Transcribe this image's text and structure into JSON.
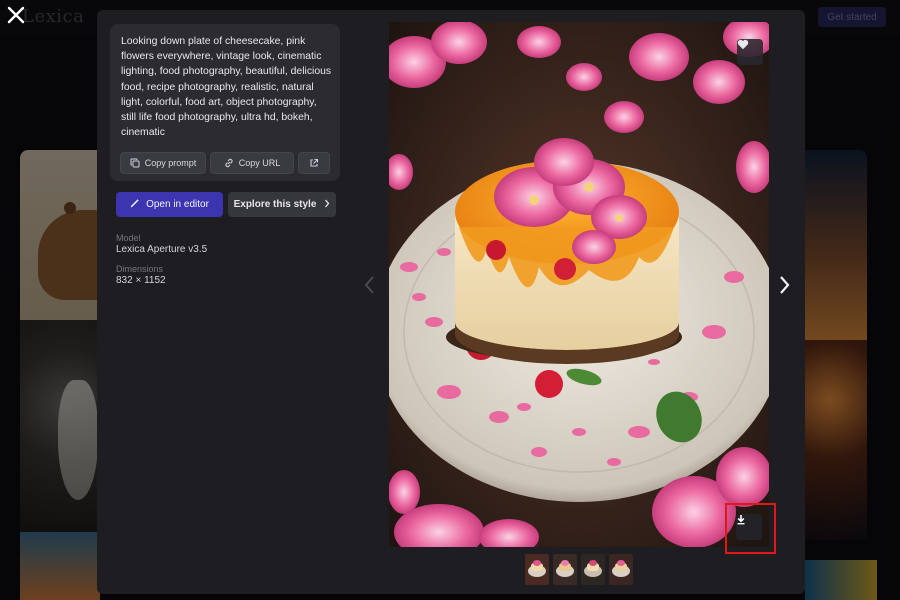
{
  "background": {
    "logo_text": "Lexica",
    "get_started_label": "Get started"
  },
  "prompt": {
    "text": "Looking down plate of cheesecake, pink flowers everywhere, vintage look, cinematic lighting, food photography, beautiful, delicious food, recipe photography, realistic, natural light, colorful, food art, object photography, still life food photography, ultra hd, bokeh, cinematic",
    "copy_prompt_label": "Copy prompt",
    "copy_url_label": "Copy URL"
  },
  "actions": {
    "open_in_editor_label": "Open in editor",
    "explore_style_label": "Explore this style"
  },
  "meta": {
    "model_label": "Model",
    "model_value": "Lexica Aperture v3.5",
    "dimensions_label": "Dimensions",
    "dimensions_value": "832 × 1152"
  },
  "colors": {
    "accent": "#3d35b0",
    "highlight_box": "#e01818",
    "modal_bg": "#1d1d22"
  },
  "icons": {
    "close": "close-icon",
    "copy": "copy-icon",
    "link": "link-icon",
    "external": "external-link-icon",
    "wand": "magic-wand-icon",
    "chevron": "chevron-right-icon",
    "heart": "heart-icon",
    "download": "download-icon",
    "prev": "chevron-left-icon",
    "next": "chevron-right-icon"
  },
  "thumbnails": [
    {
      "name": "variation-1",
      "selected": true
    },
    {
      "name": "variation-2",
      "selected": false
    },
    {
      "name": "variation-3",
      "selected": false
    },
    {
      "name": "variation-4",
      "selected": false
    }
  ]
}
